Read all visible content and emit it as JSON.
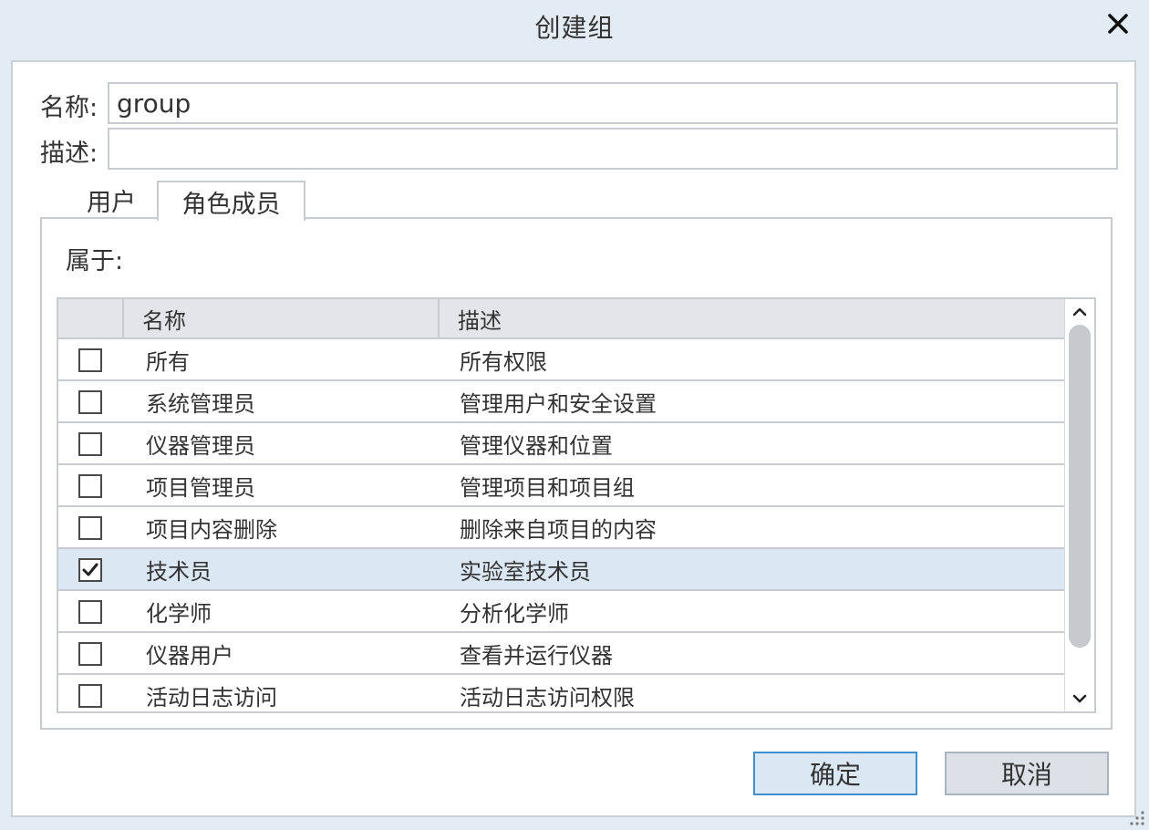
{
  "dialog": {
    "title": "创建组",
    "close_icon": "close-icon"
  },
  "form": {
    "name_label": "名称:",
    "name_value": "group",
    "description_label": "描述:",
    "description_value": ""
  },
  "tabs": [
    {
      "label": "用户",
      "active": false
    },
    {
      "label": "角色成员",
      "active": true
    }
  ],
  "panel": {
    "belongs_label": "属于:",
    "columns": {
      "name": "名称",
      "description": "描述"
    },
    "rows": [
      {
        "name": "所有",
        "description": "所有权限",
        "checked": false
      },
      {
        "name": "系统管理员",
        "description": "管理用户和安全设置",
        "checked": false
      },
      {
        "name": "仪器管理员",
        "description": "管理仪器和位置",
        "checked": false
      },
      {
        "name": "项目管理员",
        "description": "管理项目和项目组",
        "checked": false
      },
      {
        "name": "项目内容删除",
        "description": "删除来自项目的内容",
        "checked": false
      },
      {
        "name": "技术员",
        "description": "实验室技术员",
        "checked": true
      },
      {
        "name": "化学师",
        "description": "分析化学师",
        "checked": false
      },
      {
        "name": "仪器用户",
        "description": "查看并运行仪器",
        "checked": false
      },
      {
        "name": "活动日志访问",
        "description": "活动日志访问权限",
        "checked": false
      }
    ]
  },
  "buttons": {
    "ok_label": "确定",
    "cancel_label": "取消"
  },
  "colors": {
    "selected_row": "#dbe7f3",
    "primary_border": "#3f8fd0"
  }
}
